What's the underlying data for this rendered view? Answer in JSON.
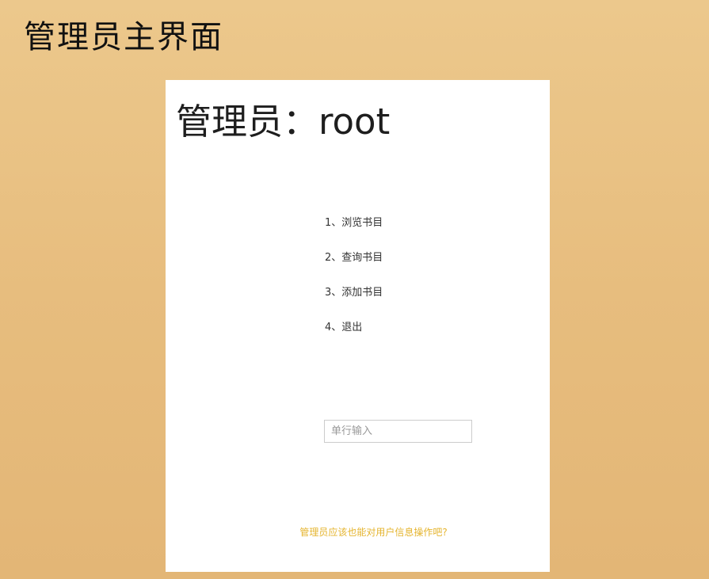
{
  "page": {
    "title": "管理员主界面"
  },
  "panel": {
    "heading": "管理员：root",
    "menu": [
      {
        "label": "1、浏览书目"
      },
      {
        "label": "2、查询书目"
      },
      {
        "label": "3、添加书目"
      },
      {
        "label": "4、退出"
      }
    ],
    "input": {
      "placeholder": "单行输入",
      "value": ""
    },
    "footer_note": "管理员应该也能对用户信息操作吧?"
  },
  "colors": {
    "background_top": "#ecc88c",
    "background_bottom": "#e3b676",
    "panel": "#ffffff",
    "note": "#e5b530"
  }
}
